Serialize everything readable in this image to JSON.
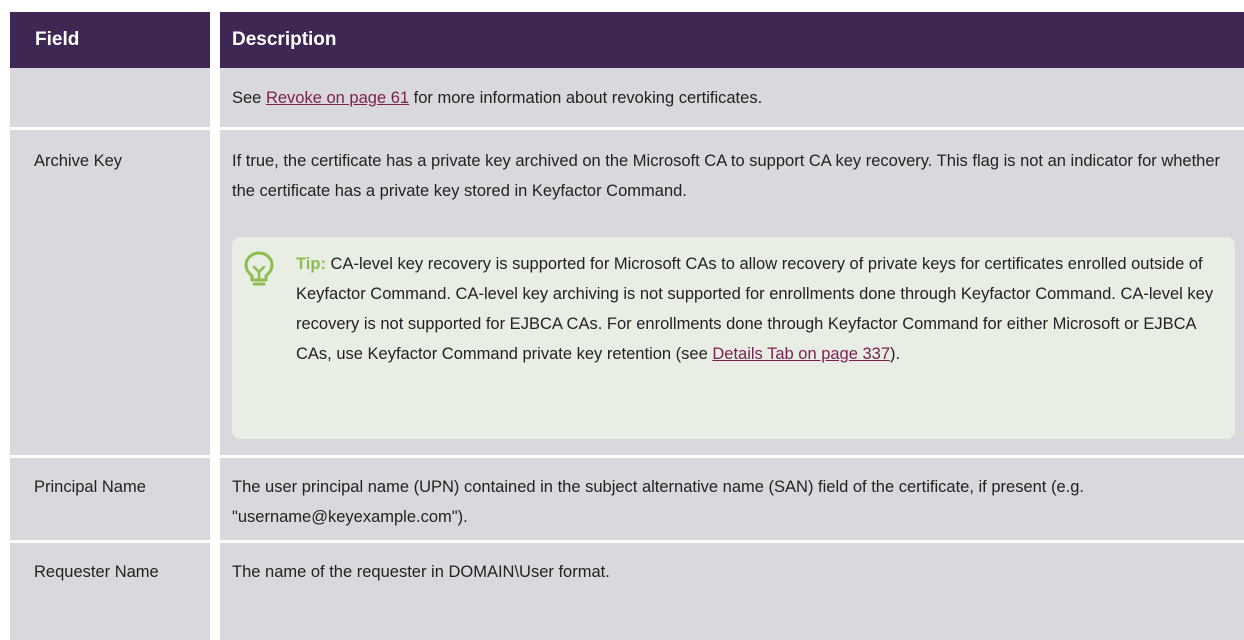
{
  "table": {
    "headers": {
      "field": "Field",
      "description": "Description"
    },
    "rows": [
      {
        "field": "",
        "desc_prefix": "See ",
        "desc_link": "Revoke on page 61",
        "desc_suffix": " for more information about revoking certificates."
      },
      {
        "field": "Archive Key",
        "description": "If true, the certificate has a private key archived on the Microsoft CA to support CA key recovery. This flag is not an indicator for whether the certificate has a private key stored in Keyfactor Command.",
        "tip": {
          "label": "Tip:",
          "text": " CA-level key recovery is supported for Microsoft CAs to allow recovery of private keys for certificates enrolled outside of Keyfactor Command. CA-level key archiving is not supported for enrollments done through Keyfactor Command. CA-level key recovery is not supported for EJBCA CAs. For enrollments done through Keyfactor Command for either Microsoft or EJBCA CAs, use Keyfactor Command private key retention (see ",
          "link": "Details Tab on page 337",
          "suffix": ").",
          "icon": "lightbulb-icon"
        }
      },
      {
        "field": "Principal Name",
        "description": "The user principal name (UPN) contained in the subject alternative name (SAN) field of the certificate, if present (e.g. \"username@keyexample.com\")."
      },
      {
        "field": "Requester Name",
        "description": "The name of the requester in DOMAIN\\User format."
      }
    ]
  },
  "colors": {
    "header_bg": "#3f2754",
    "row_bg": "#d9d8dd",
    "link": "#7b1f4f",
    "tip_bg": "#e9eee4",
    "tip_accent": "#8bbd4f"
  }
}
